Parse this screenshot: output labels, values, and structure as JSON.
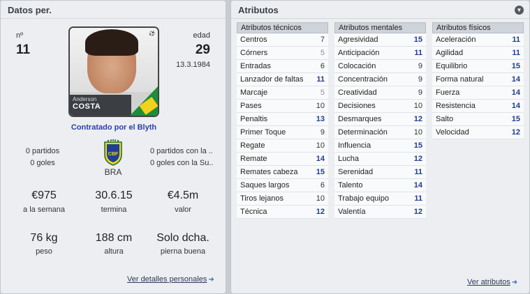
{
  "left_panel": {
    "title": "Datos per.",
    "number_label": "nº",
    "number_value": "11",
    "age_label": "edad",
    "age_value": "29",
    "birth_date": "13.3.1984",
    "player_first_name": "Anderson",
    "player_last_name": "COSTA",
    "contract_text": "Contratado por el Blyth",
    "left_stats": {
      "games": "0 partidos",
      "goals": "0 goles"
    },
    "nation": "BRA",
    "right_stats": {
      "games": "0 partidos con la ..",
      "goals": "0 goles con la Su.."
    },
    "wage": {
      "value": "€975",
      "label": "a la semana"
    },
    "expiry": {
      "value": "30.6.15",
      "label": "termina"
    },
    "value": {
      "value": "€4.5m",
      "label": "valor"
    },
    "weight": {
      "value": "76 kg",
      "label": "peso"
    },
    "height": {
      "value": "188 cm",
      "label": "altura"
    },
    "foot": {
      "value": "Solo dcha.",
      "label": "pierna buena"
    },
    "details_link": "Ver detalles personales"
  },
  "right_panel": {
    "title": "Atributos",
    "attributes_link": "Ver atributos",
    "columns": [
      {
        "heading": "Atributos técnicos",
        "rows": [
          {
            "name": "Centros",
            "value": "7"
          },
          {
            "name": "Córners",
            "value": "5"
          },
          {
            "name": "Entradas",
            "value": "6"
          },
          {
            "name": "Lanzador de faltas",
            "value": "11"
          },
          {
            "name": "Marcaje",
            "value": "5"
          },
          {
            "name": "Pases",
            "value": "10"
          },
          {
            "name": "Penaltis",
            "value": "13"
          },
          {
            "name": "Primer Toque",
            "value": "9"
          },
          {
            "name": "Regate",
            "value": "10"
          },
          {
            "name": "Remate",
            "value": "14"
          },
          {
            "name": "Remates cabeza",
            "value": "15"
          },
          {
            "name": "Saques largos",
            "value": "6"
          },
          {
            "name": "Tiros lejanos",
            "value": "10"
          },
          {
            "name": "Técnica",
            "value": "12"
          }
        ]
      },
      {
        "heading": "Atributos mentales",
        "rows": [
          {
            "name": "Agresividad",
            "value": "15"
          },
          {
            "name": "Anticipación",
            "value": "11"
          },
          {
            "name": "Colocación",
            "value": "9"
          },
          {
            "name": "Concentración",
            "value": "9"
          },
          {
            "name": "Creatividad",
            "value": "9"
          },
          {
            "name": "Decisiones",
            "value": "10"
          },
          {
            "name": "Desmarques",
            "value": "12"
          },
          {
            "name": "Determinación",
            "value": "10"
          },
          {
            "name": "Influencia",
            "value": "15"
          },
          {
            "name": "Lucha",
            "value": "12"
          },
          {
            "name": "Serenidad",
            "value": "11"
          },
          {
            "name": "Talento",
            "value": "14"
          },
          {
            "name": "Trabajo equipo",
            "value": "11"
          },
          {
            "name": "Valentía",
            "value": "12"
          }
        ]
      },
      {
        "heading": "Atributos físicos",
        "rows": [
          {
            "name": "Aceleración",
            "value": "11"
          },
          {
            "name": "Agilidad",
            "value": "11"
          },
          {
            "name": "Equilibrio",
            "value": "15"
          },
          {
            "name": "Forma natural",
            "value": "14"
          },
          {
            "name": "Fuerza",
            "value": "14"
          },
          {
            "name": "Resistencia",
            "value": "14"
          },
          {
            "name": "Salto",
            "value": "15"
          },
          {
            "name": "Velocidad",
            "value": "12"
          }
        ]
      }
    ]
  },
  "colors": {
    "high_value": "#1f3d8f",
    "low_value": "#8a8f96",
    "link_arrow": "#2f6db5",
    "panel_bg": "#eceef1"
  }
}
